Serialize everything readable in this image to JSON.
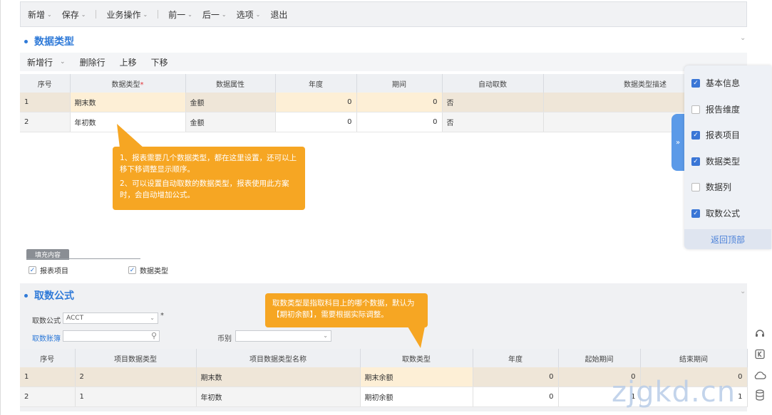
{
  "toolbar": {
    "items": [
      {
        "label": "新增",
        "has_menu": true
      },
      {
        "label": "保存",
        "has_menu": true
      },
      {
        "label": "业务操作",
        "has_menu": true
      },
      {
        "label": "前一",
        "has_menu": true
      },
      {
        "label": "后一",
        "has_menu": true
      },
      {
        "label": "选项",
        "has_menu": true
      },
      {
        "label": "退出",
        "has_menu": false
      }
    ]
  },
  "data_type_section": {
    "title": "数据类型",
    "sub_toolbar": {
      "add_row": "新增行",
      "delete_row": "删除行",
      "move_up": "上移",
      "move_down": "下移"
    },
    "columns": [
      "序号",
      "数据类型",
      "数据属性",
      "年度",
      "期间",
      "自动取数",
      "数据类型描述"
    ],
    "rows": [
      {
        "seq": "1",
        "type": "期末数",
        "attr": "金额",
        "year": "0",
        "period": "0",
        "auto": "否",
        "desc": ""
      },
      {
        "seq": "2",
        "type": "年初数",
        "attr": "金额",
        "year": "0",
        "period": "0",
        "auto": "否",
        "desc": ""
      }
    ]
  },
  "callout1": {
    "line1": "1、报表需要几个数据类型，都在这里设置，还可以上移下移调整显示顺序。",
    "line2": "2、可以设置自动取数的数据类型，报表使用此方案时，会自动增加公式。"
  },
  "fill_content": {
    "tab": "填充内容",
    "options": [
      {
        "label": "报表项目",
        "checked": true
      },
      {
        "label": "数据类型",
        "checked": true
      }
    ]
  },
  "formula_section": {
    "title": "取数公式",
    "formula_label": "取数公式",
    "formula_value": "ACCT",
    "ledger_link": "取数账簿",
    "currency_label": "币别",
    "columns": [
      "序号",
      "项目数据类型",
      "项目数据类型名称",
      "取数类型",
      "年度",
      "起始期间",
      "结束期间"
    ],
    "rows": [
      {
        "seq": "1",
        "item_type": "2",
        "item_type_name": "期末数",
        "fetch_type": "期末余额",
        "year": "0",
        "start": "0",
        "end": "0"
      },
      {
        "seq": "2",
        "item_type": "1",
        "item_type_name": "年初数",
        "fetch_type": "期初余额",
        "year": "0",
        "start": "1",
        "end": "1"
      }
    ]
  },
  "callout2": {
    "text": "取数类型是指取科目上的哪个数据，默认为【期初余额】，需要根据实际调整。"
  },
  "right_panel": {
    "items": [
      {
        "label": "基本信息",
        "checked": true
      },
      {
        "label": "报告维度",
        "checked": false
      },
      {
        "label": "报表项目",
        "checked": true
      },
      {
        "label": "数据类型",
        "checked": true
      },
      {
        "label": "数据列",
        "checked": false
      },
      {
        "label": "取数公式",
        "checked": true
      }
    ],
    "back_to_top": "返回顶部",
    "collapse_glyph": "»"
  },
  "watermark": "zjgkd.cn",
  "colors": {
    "accent": "#2f7ad8",
    "callout": "#f6a623",
    "selected_row": "#fdefd6"
  }
}
